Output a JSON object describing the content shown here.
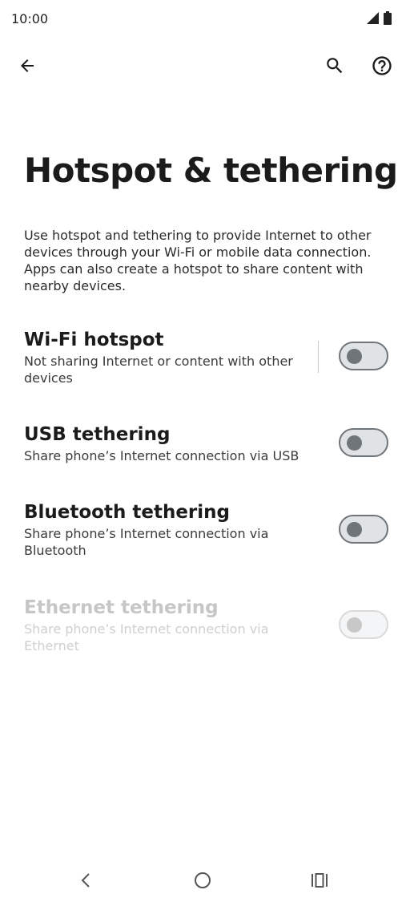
{
  "status_bar": {
    "time": "10:00",
    "icons": [
      "signal-icon",
      "battery-icon"
    ]
  },
  "app_bar": {
    "back_icon": "arrow-left-icon",
    "search_icon": "search-icon",
    "help_icon": "help-circle-icon"
  },
  "page": {
    "title": "Hotspot & tethering",
    "description": "Use hotspot and tethering to provide Internet to other devices through your Wi-Fi or mobile data connection. Apps can also create a hotspot to share content with nearby devices."
  },
  "settings": [
    {
      "title": "Wi-Fi hotspot",
      "summary": "Not sharing Internet or content with other devices",
      "enabled": true,
      "checked": false
    },
    {
      "title": "USB tethering",
      "summary": "Share phone’s Internet connection via USB",
      "enabled": true,
      "checked": false
    },
    {
      "title": "Bluetooth tethering",
      "summary": "Share phone’s Internet connection via Bluetooth",
      "enabled": true,
      "checked": false
    },
    {
      "title": "Ethernet tethering",
      "summary": "Share phone’s Internet connection via Ethernet",
      "enabled": false,
      "checked": false
    }
  ],
  "nav_bar": {
    "icons": [
      "nav-back-icon",
      "nav-home-icon",
      "nav-recents-icon"
    ]
  },
  "colors": {
    "text_primary": "#1b1b1b",
    "toggle_border": "#6f7579",
    "toggle_track": "#dfe3e6",
    "disabled_text": "#c6c6c6"
  }
}
